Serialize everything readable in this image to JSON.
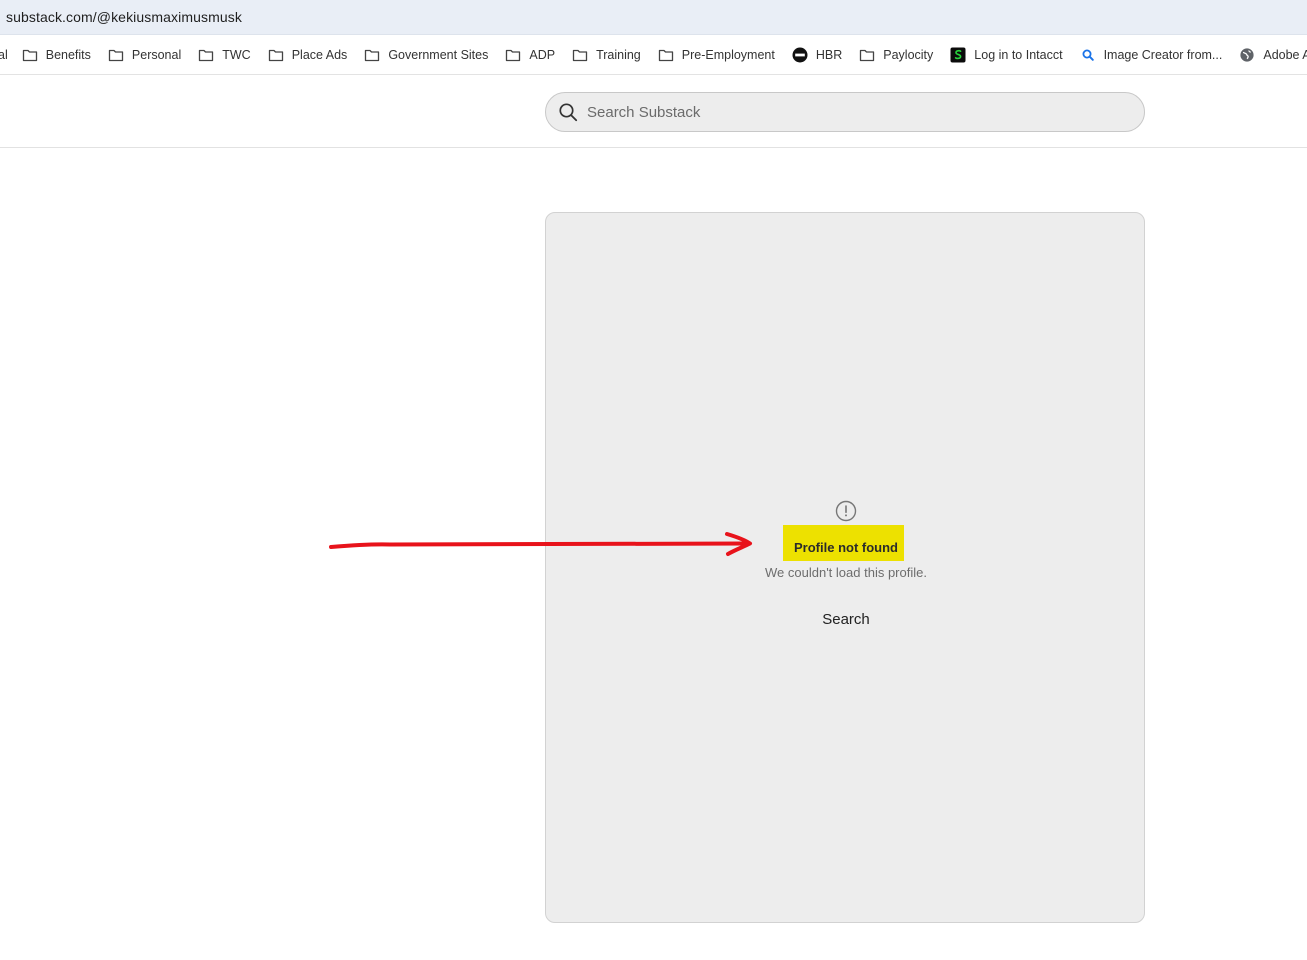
{
  "browser": {
    "url": "substack.com/@kekiusmaximusmusk"
  },
  "bookmarks": {
    "cut_off_label": "al",
    "items": [
      {
        "label": "Benefits",
        "icon": "folder-icon"
      },
      {
        "label": "Personal",
        "icon": "folder-icon"
      },
      {
        "label": "TWC",
        "icon": "folder-icon"
      },
      {
        "label": "Place Ads",
        "icon": "folder-icon"
      },
      {
        "label": "Government Sites",
        "icon": "folder-icon"
      },
      {
        "label": "ADP",
        "icon": "folder-icon"
      },
      {
        "label": "Training",
        "icon": "folder-icon"
      },
      {
        "label": "Pre-Employment",
        "icon": "folder-icon"
      },
      {
        "label": "HBR",
        "icon": "hbr-logo-icon"
      },
      {
        "label": "Paylocity",
        "icon": "folder-icon"
      },
      {
        "label": "Log in to Intacct",
        "icon": "intacct-logo-icon"
      },
      {
        "label": "Image Creator from...",
        "icon": "magnifier-icon"
      },
      {
        "label": "Adobe Acrobat",
        "icon": "globe-icon"
      }
    ]
  },
  "search": {
    "placeholder": "Search Substack"
  },
  "error": {
    "title": "Profile not found",
    "subtitle": "We couldn't load this profile.",
    "search_button": "Search"
  },
  "annotation": {
    "arrow_color": "#e8131b",
    "highlight_color": "#ede100"
  }
}
